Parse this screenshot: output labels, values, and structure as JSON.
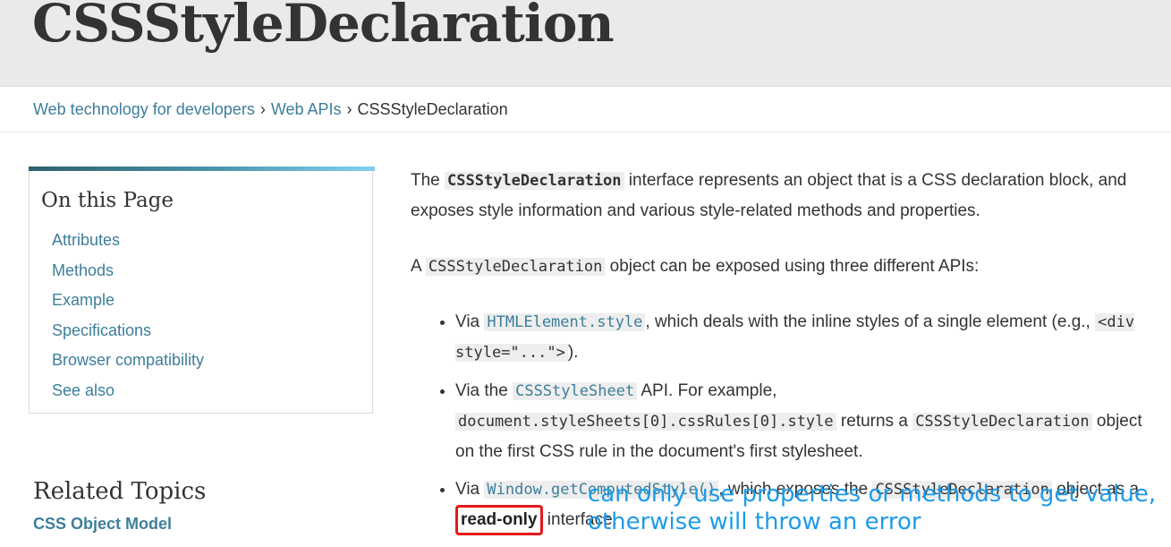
{
  "header": {
    "title": "CSSStyleDeclaration"
  },
  "breadcrumb": {
    "items": [
      "Web technology for developers",
      "Web APIs"
    ],
    "current": "CSSStyleDeclaration",
    "separator": "›"
  },
  "toc": {
    "heading": "On this Page",
    "items": [
      "Attributes",
      "Methods",
      "Example",
      "Specifications",
      "Browser compatibility",
      "See also"
    ]
  },
  "related": {
    "heading": "Related Topics",
    "link": "CSS Object Model"
  },
  "content": {
    "p1": {
      "pre": "The ",
      "code": "CSSStyleDeclaration",
      "post": " interface represents an object that is a CSS declaration block, and exposes style information and various style-related methods and properties."
    },
    "p2": {
      "pre": "A ",
      "code": "CSSStyleDeclaration",
      "post": " object can be exposed using three different APIs:"
    },
    "li1": {
      "pre": "Via ",
      "link": "HTMLElement.style",
      "mid": ", which deals with the inline styles of a single element (e.g., ",
      "code": "<div style=\"...\">",
      "post": ")."
    },
    "li2": {
      "pre": "Via the ",
      "link": "CSSStyleSheet",
      "mid": " API. For example, ",
      "code": "document.styleSheets[0].cssRules[0].style",
      "mid2": " returns a ",
      "code2": "CSSStyleDeclaration",
      "post": " object on the first CSS rule in the document's first stylesheet."
    },
    "li3": {
      "pre": "Via ",
      "link": "Window.getComputedStyle()",
      "mid": ", which exposes the ",
      "code": "CSSStyleDeclaration",
      "mid2": " object as a ",
      "strong": "read-only",
      "post": " interface."
    }
  },
  "annotation": {
    "line1": "can only use properties or methods to get value,",
    "line2": "otherwise will throw an error"
  },
  "colors": {
    "link": "#3d7e9a",
    "annotation": "#1e9be8",
    "highlight_box": "#e61919",
    "hero_bg": "#eaeaea"
  }
}
